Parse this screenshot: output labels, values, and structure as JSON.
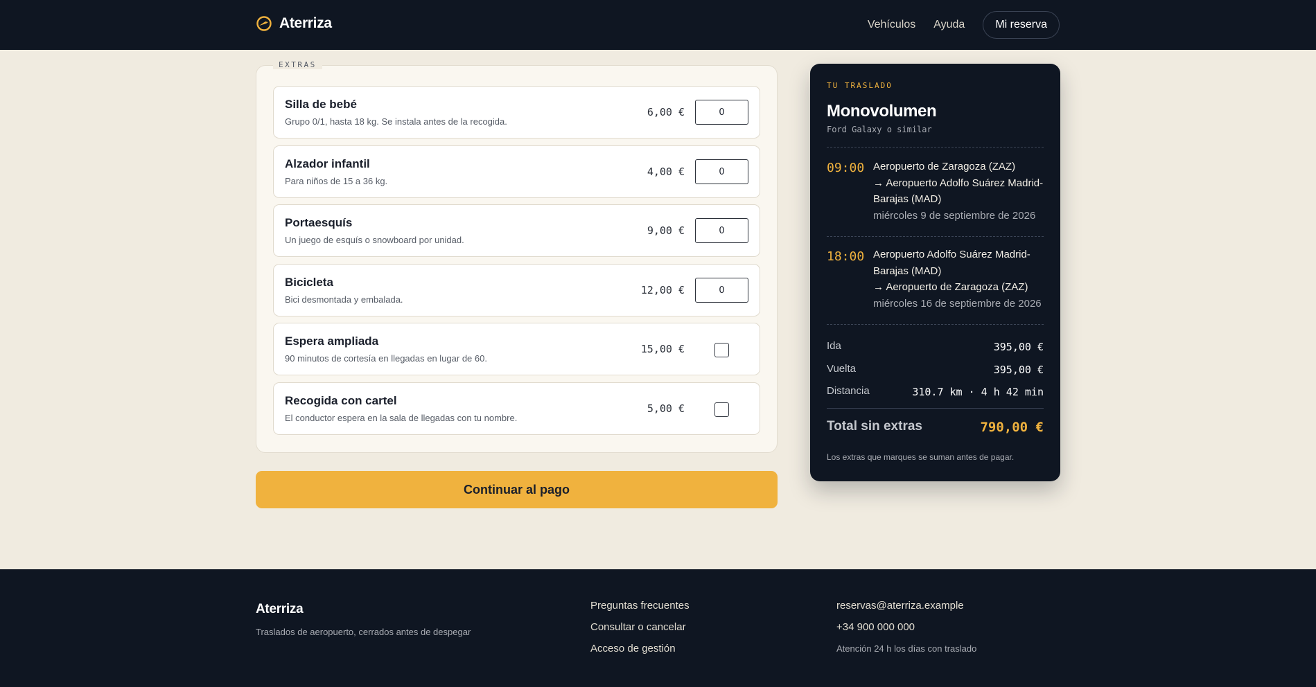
{
  "header": {
    "brand": "Aterriza",
    "nav": [
      "Vehículos",
      "Ayuda"
    ],
    "cta": "Mi reserva"
  },
  "extras": {
    "legend": "EXTRAS",
    "items": [
      {
        "name": "Silla de bebé",
        "desc": "Grupo 0/1, hasta 18 kg. Se instala antes de la recogida.",
        "price": "6,00 €",
        "control": "quantity",
        "value": "0"
      },
      {
        "name": "Alzador infantil",
        "desc": "Para niños de 15 a 36 kg.",
        "price": "4,00 €",
        "control": "quantity",
        "value": "0"
      },
      {
        "name": "Portaesquís",
        "desc": "Un juego de esquís o snowboard por unidad.",
        "price": "9,00 €",
        "control": "quantity",
        "value": "0"
      },
      {
        "name": "Bicicleta",
        "desc": "Bici desmontada y embalada.",
        "price": "12,00 €",
        "control": "quantity",
        "value": "0"
      },
      {
        "name": "Espera ampliada",
        "desc": "90 minutos de cortesía en llegadas en lugar de 60.",
        "price": "15,00 €",
        "control": "checkbox",
        "checked": false
      },
      {
        "name": "Recogida con cartel",
        "desc": "El conductor espera en la sala de llegadas con tu nombre.",
        "price": "5,00 €",
        "control": "checkbox",
        "checked": false
      }
    ],
    "continue_label": "Continuar al pago"
  },
  "summary": {
    "eyebrow": "TU TRASLADO",
    "vehicle": "Monovolumen",
    "model": "Ford Galaxy o similar",
    "legs": [
      {
        "time": "09:00",
        "from": "Aeropuerto de Zaragoza (ZAZ)",
        "to": "→ Aeropuerto Adolfo Suárez Madrid-Barajas (MAD)",
        "date": "miércoles 9 de septiembre de 2026"
      },
      {
        "time": "18:00",
        "from": "Aeropuerto Adolfo Suárez Madrid-Barajas (MAD)",
        "to": "→ Aeropuerto de Zaragoza (ZAZ)",
        "date": "miércoles 16 de septiembre de 2026"
      }
    ],
    "rows": [
      {
        "label": "Ida",
        "value": "395,00 €"
      },
      {
        "label": "Vuelta",
        "value": "395,00 €"
      },
      {
        "label": "Distancia",
        "value": "310.7 km · 4 h 42 min"
      }
    ],
    "total_label": "Total sin extras",
    "total_value": "790,00 €",
    "note": "Los extras que marques se suman antes de pagar."
  },
  "footer": {
    "brand": "Aterriza",
    "tagline": "Traslados de aeropuerto, cerrados antes de despegar",
    "links": [
      "Preguntas frecuentes",
      "Consultar o cancelar",
      "Acceso de gestión"
    ],
    "email": "reservas@aterriza.example",
    "phone": "+34 900 000 000",
    "hours": "Atención 24 h los días con traslado"
  },
  "colors": {
    "navy": "#0f1622",
    "accent": "#f0b23e",
    "background": "#f0ebe0"
  },
  "icons": {
    "brand": "plane-landing-logo-icon"
  }
}
